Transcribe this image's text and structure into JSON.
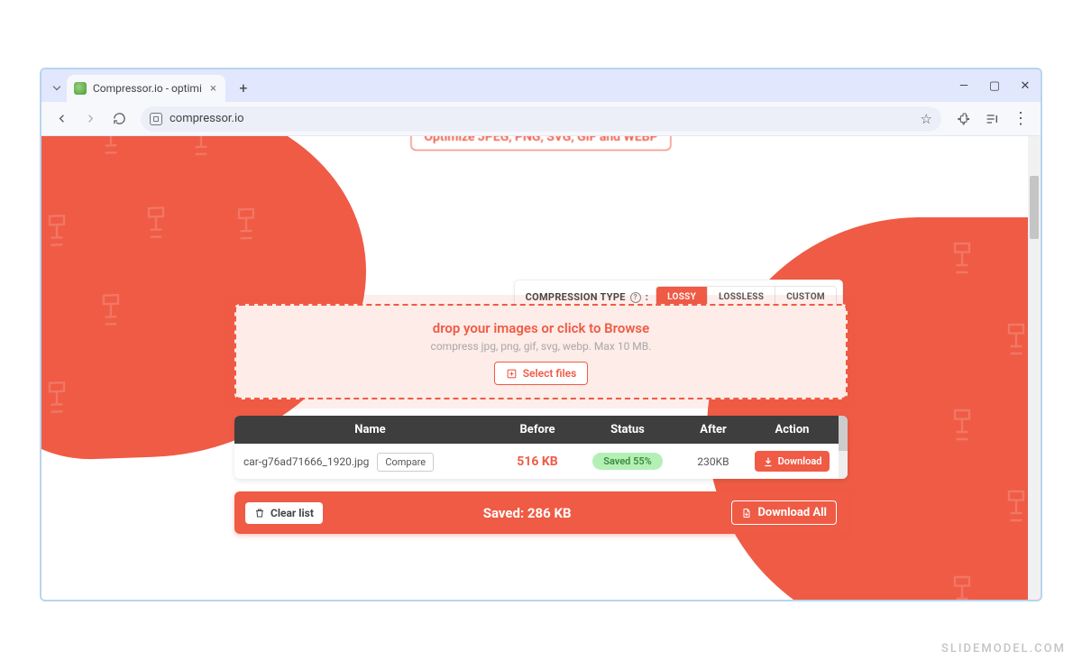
{
  "watermark": "SLIDEMODEL.COM",
  "browser": {
    "tab_title": "Compressor.io - optimize and c",
    "url": "compressor.io"
  },
  "hero_pill": "Optimize JPEG, PNG, SVG, GIF and WEBP",
  "type_picker": {
    "label": "COMPRESSION TYPE",
    "options": [
      "LOSSY",
      "LOSSLESS",
      "CUSTOM"
    ],
    "active": "LOSSY"
  },
  "dropzone": {
    "headline": "drop your images or click to Browse",
    "subline": "compress jpg, png, gif, svg, webp. Max 10 MB.",
    "button": "Select files"
  },
  "table": {
    "headers": {
      "name": "Name",
      "before": "Before",
      "status": "Status",
      "after": "After",
      "action": "Action"
    },
    "rows": [
      {
        "name": "car-g76ad71666_1920.jpg",
        "compare": "Compare",
        "before": "516 KB",
        "status": "Saved 55%",
        "after": "230KB",
        "action": "Download"
      }
    ]
  },
  "footer": {
    "clear": "Clear list",
    "saved": "Saved: 286 KB",
    "download_all": "Download All"
  }
}
